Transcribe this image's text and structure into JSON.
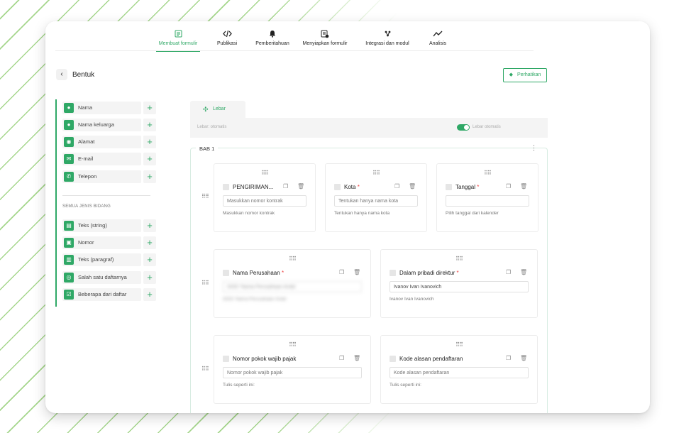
{
  "nav": {
    "items": [
      {
        "label": "Membuat formulir",
        "icon": "form-icon",
        "active": true
      },
      {
        "label": "Publikasi",
        "icon": "code-icon",
        "active": false
      },
      {
        "label": "Pemberitahuan",
        "icon": "bell-icon",
        "active": false
      },
      {
        "label": "Menyiapkan formulir",
        "icon": "form-settings-icon",
        "active": false
      },
      {
        "label": "Integrasi dan modul",
        "icon": "integration-icon",
        "active": false
      },
      {
        "label": "Analisis",
        "icon": "chart-line-icon",
        "active": false
      }
    ]
  },
  "header": {
    "title": "Bentuk",
    "notice_label": "Perhatikan"
  },
  "sidebar": {
    "contact_fields": [
      {
        "label": "Nama",
        "icon": "person-icon"
      },
      {
        "label": "Nama keluarga",
        "icon": "person-icon"
      },
      {
        "label": "Alamat",
        "icon": "location-pin-icon"
      },
      {
        "label": "E-mail",
        "icon": "mail-icon"
      },
      {
        "label": "Telepon",
        "icon": "phone-icon"
      }
    ],
    "all_fields_heading": "SEMUA JENIS BIDANG",
    "field_types": [
      {
        "label": "Teks (string)",
        "icon": "text-icon"
      },
      {
        "label": "Nomor",
        "icon": "number-icon"
      },
      {
        "label": "Teks (paragraf)",
        "icon": "paragraph-icon"
      },
      {
        "label": "Salah satu daftarnya",
        "icon": "radio-icon"
      },
      {
        "label": "Beberapa dari daftar",
        "icon": "checkbox-icon"
      }
    ]
  },
  "main": {
    "tab_label": "Lebar",
    "width_left": "Lebar: otomatis",
    "width_toggle_label": "Lebar otomatis",
    "width_toggle_on": true,
    "section_title": "BAB 1",
    "fields": {
      "kontrak": {
        "label": "PENGIRIMAN...",
        "required": false,
        "placeholder": "Masukkan nomor kontrak",
        "hint": "Masukkan nomor kontrak"
      },
      "kota": {
        "label": "Kota",
        "required": true,
        "placeholder": "Tentukan hanya nama kota",
        "hint": "Tentukan hanya nama kota"
      },
      "tanggal": {
        "label": "Tanggal",
        "required": true,
        "placeholder": "",
        "hint": "Pilih tanggal dari kalender"
      },
      "perusahaan": {
        "label": "Nama Perusahaan",
        "required": true,
        "placeholder": "OOO 'Nama Perusahaan Anda'",
        "hint": "OOO 'Nama Perusahaan Anda'"
      },
      "direktur": {
        "label": "Dalam pribadi direktur",
        "required": true,
        "value": "Ivanov Ivan Ivanovich",
        "hint": "Ivanov Ivan Ivanovich"
      },
      "npwp": {
        "label": "Nomor pokok wajib pajak",
        "required": false,
        "placeholder": "Nomor pokok wajib pajak",
        "hint": "Tulis seperti ini:"
      },
      "kode": {
        "label": "Kode alasan pendaftaran",
        "required": false,
        "placeholder": "Kode alasan pendaftaran",
        "hint": "Tulis seperti ini:"
      }
    },
    "required_mark": "*"
  },
  "colors": {
    "accent": "#2fa866",
    "required": "#e44444"
  }
}
